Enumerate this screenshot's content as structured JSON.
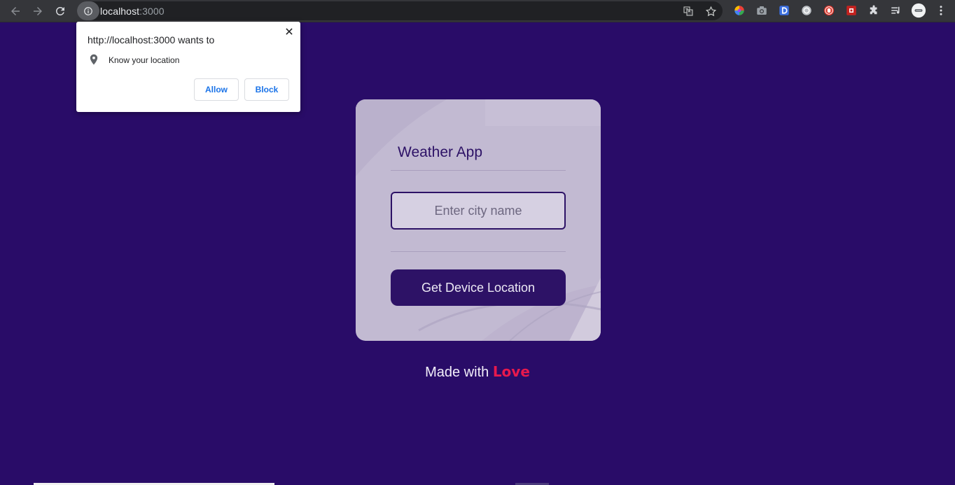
{
  "browser": {
    "url_host": "localhost",
    "url_port": ":3000",
    "icons": {
      "back": "arrow-left-icon",
      "forward": "arrow-right-icon",
      "reload": "reload-icon",
      "site_info": "info-icon",
      "translate": "translate-icon",
      "bookmark": "star-icon"
    },
    "extensions": [
      "color-wheel-extension",
      "camera-extension",
      "d-extension",
      "ring-extension",
      "stop-hand-extension",
      "red-square-extension",
      "puzzle-extensions-icon",
      "reading-list-icon",
      "profile-avatar",
      "kebab-menu-icon"
    ]
  },
  "permission_popup": {
    "title": "http://localhost:3000 wants to",
    "permission": "Know your location",
    "permission_icon": "location-pin-icon",
    "allow_label": "Allow",
    "block_label": "Block"
  },
  "app": {
    "title": "Weather App",
    "city_input_placeholder": "Enter city name",
    "city_input_value": "",
    "location_button_label": "Get Device Location"
  },
  "footer": {
    "prefix": "Made with",
    "emphasis": "Love"
  },
  "colors": {
    "page_background": "#290c68",
    "card_background": "#c2bad2",
    "primary": "#2d1266",
    "love": "#e8194d",
    "popup_button_text": "#1a73e8"
  }
}
